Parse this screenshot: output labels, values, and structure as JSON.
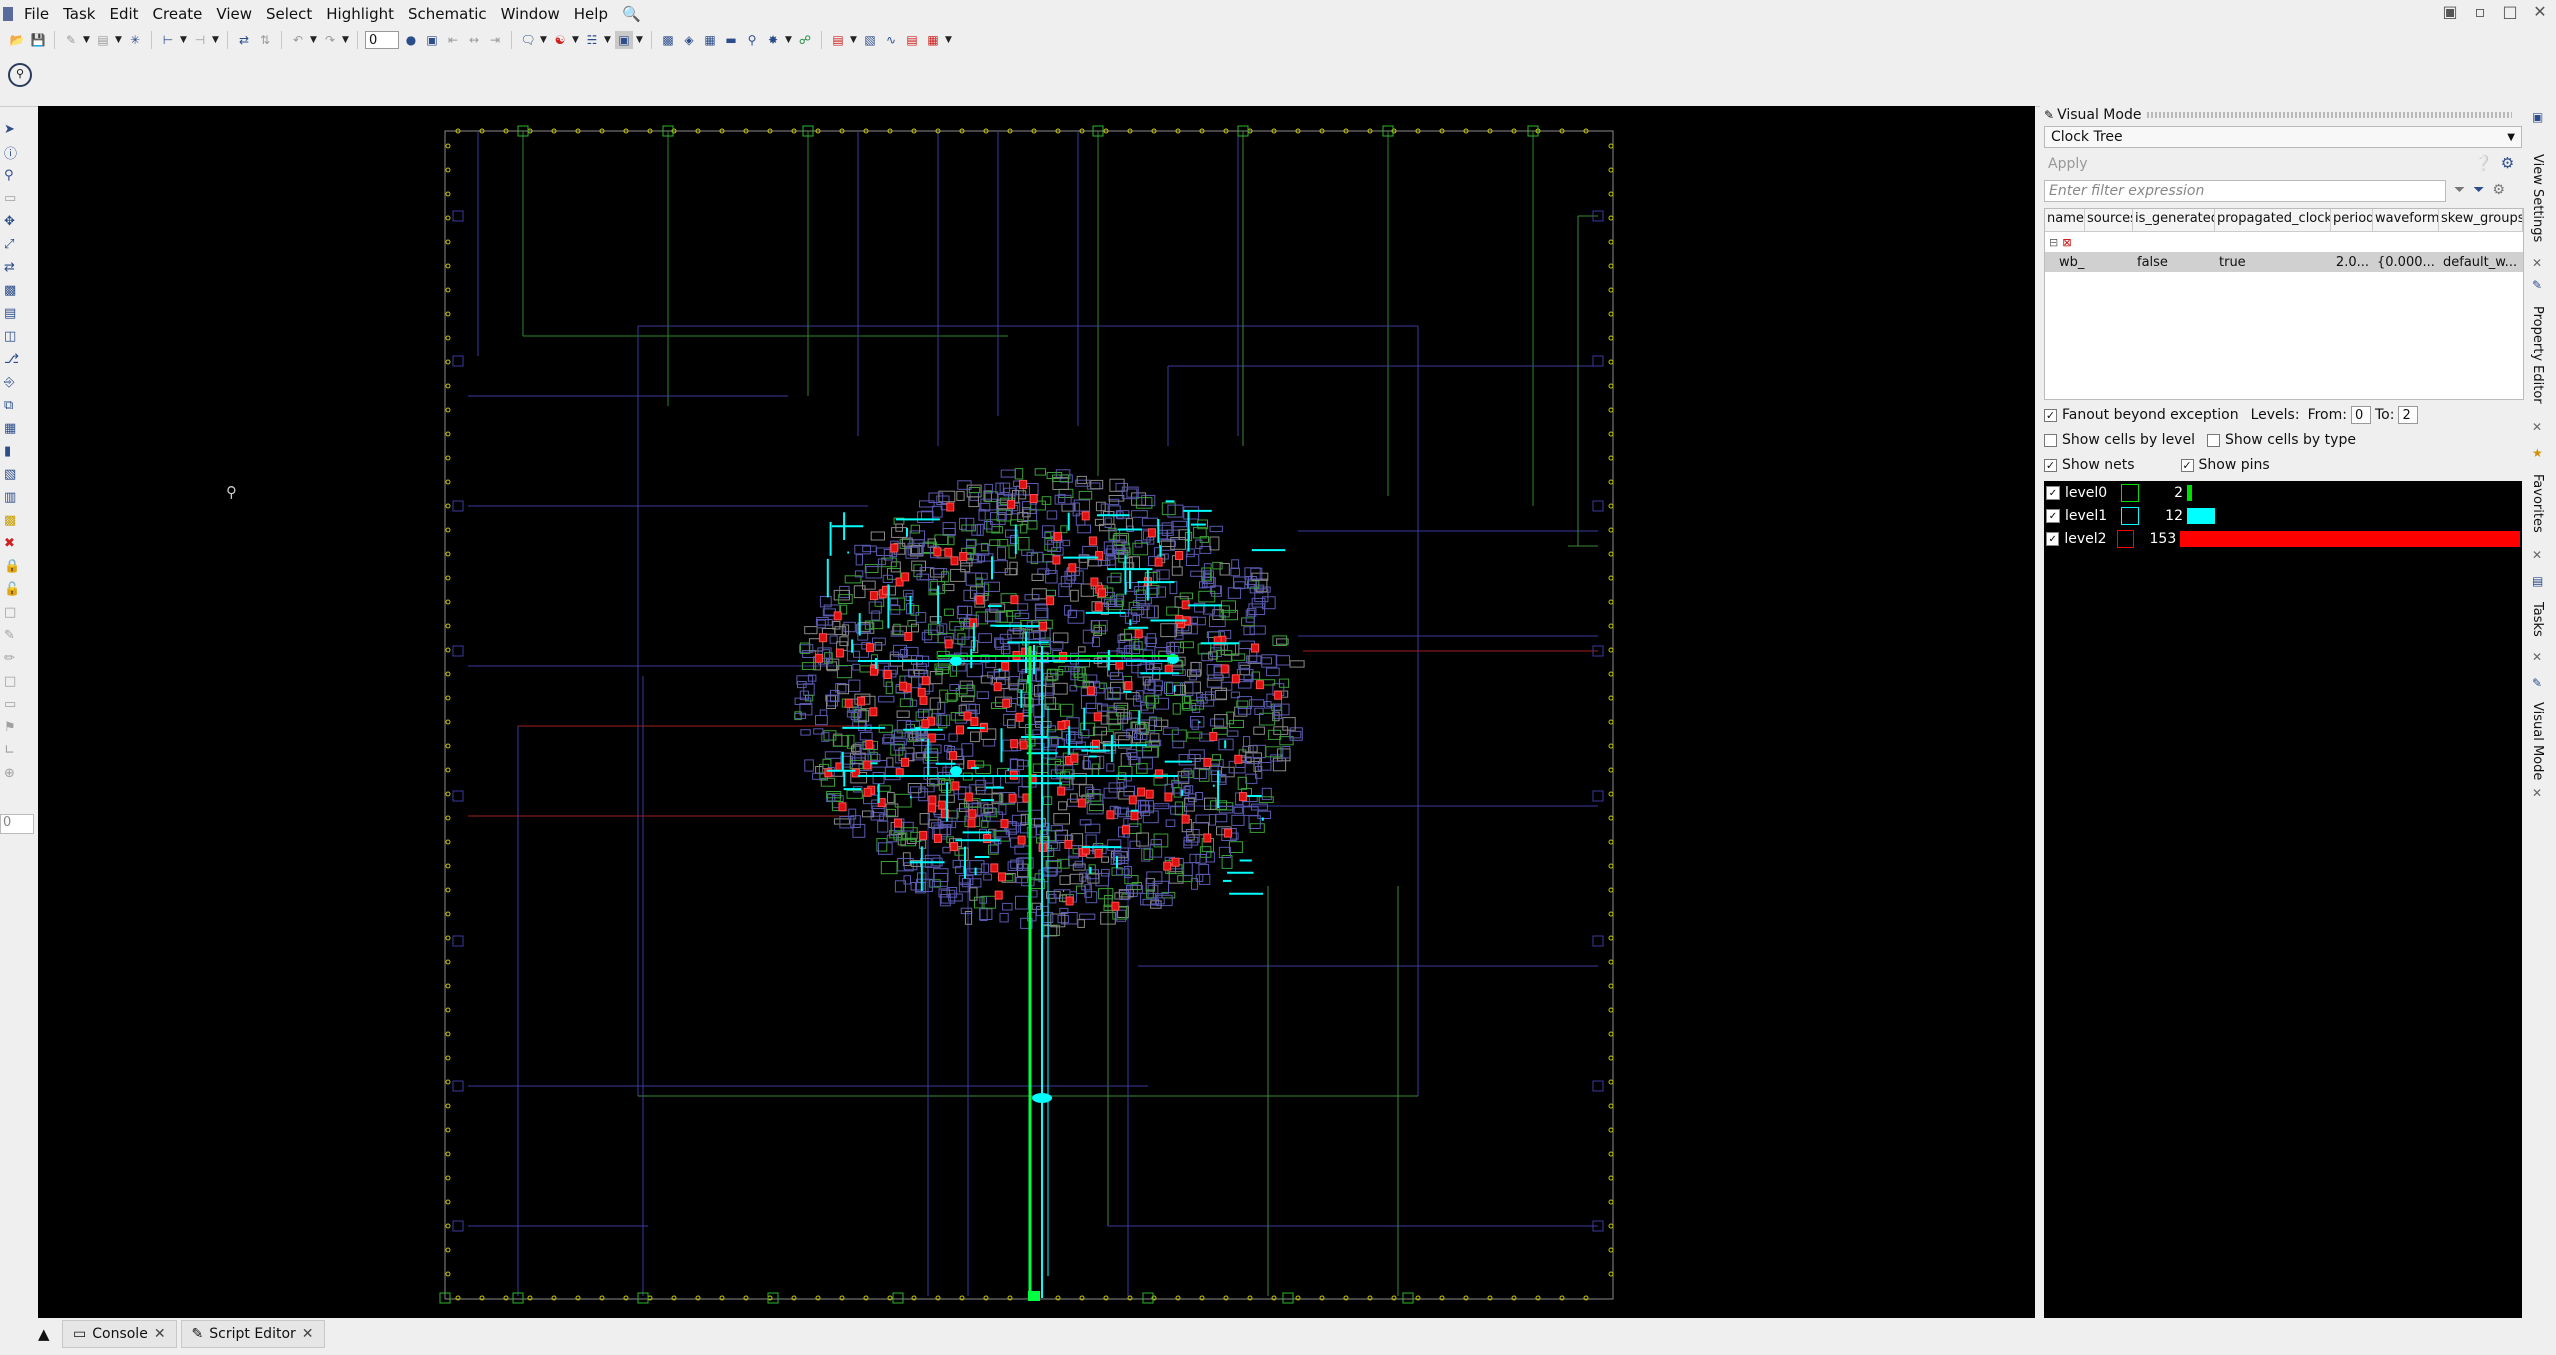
{
  "menu": [
    "File",
    "Task",
    "Edit",
    "Create",
    "View",
    "Select",
    "Highlight",
    "Schematic",
    "Window",
    "Help"
  ],
  "toolbar": {
    "layer_value": "0"
  },
  "left_strip": {
    "value": "0"
  },
  "visual_mode": {
    "title": "Visual Mode",
    "mode": "Clock Tree",
    "apply_label": "Apply",
    "filter_placeholder": "Enter filter expression",
    "table": {
      "columns": [
        "name",
        "sources",
        "is_generated",
        "propagated_clock",
        "period",
        "waveform",
        "skew_groups"
      ],
      "rows": [
        {
          "name": "wb_...",
          "sources": "",
          "is_generated": "false",
          "propagated_clock": "true",
          "period": "2.0...",
          "waveform": "{0.000...",
          "skew_groups": "default_w..."
        }
      ]
    },
    "options": {
      "fanout_label": "Fanout beyond exception",
      "levels_label": "Levels:",
      "from_label": "From:",
      "from_value": "0",
      "to_label": "To:",
      "to_value": "2",
      "cells_by_level": "Show cells by level",
      "cells_by_type": "Show cells by type",
      "show_nets": "Show nets",
      "show_pins": "Show pins"
    },
    "levels": [
      {
        "name": "level0",
        "count": "2",
        "color": "#00e000",
        "fraction": 0.013
      },
      {
        "name": "level1",
        "count": "12",
        "color": "#00ffff",
        "fraction": 0.078
      },
      {
        "name": "level2",
        "count": "153",
        "color": "#ff0000",
        "fraction": 1.0
      }
    ]
  },
  "side_tabs": [
    "View Settings",
    "Property Editor",
    "Favorites",
    "Tasks",
    "Visual Mode"
  ],
  "bottom_tabs": [
    "Console",
    "Script Editor"
  ],
  "icons": [
    "zoom-icon",
    "select-arrow-icon",
    "info-icon",
    "cursor-zoom-icon",
    "close-icon",
    "save-icon",
    "open-icon",
    "undo-icon",
    "redo-icon"
  ]
}
